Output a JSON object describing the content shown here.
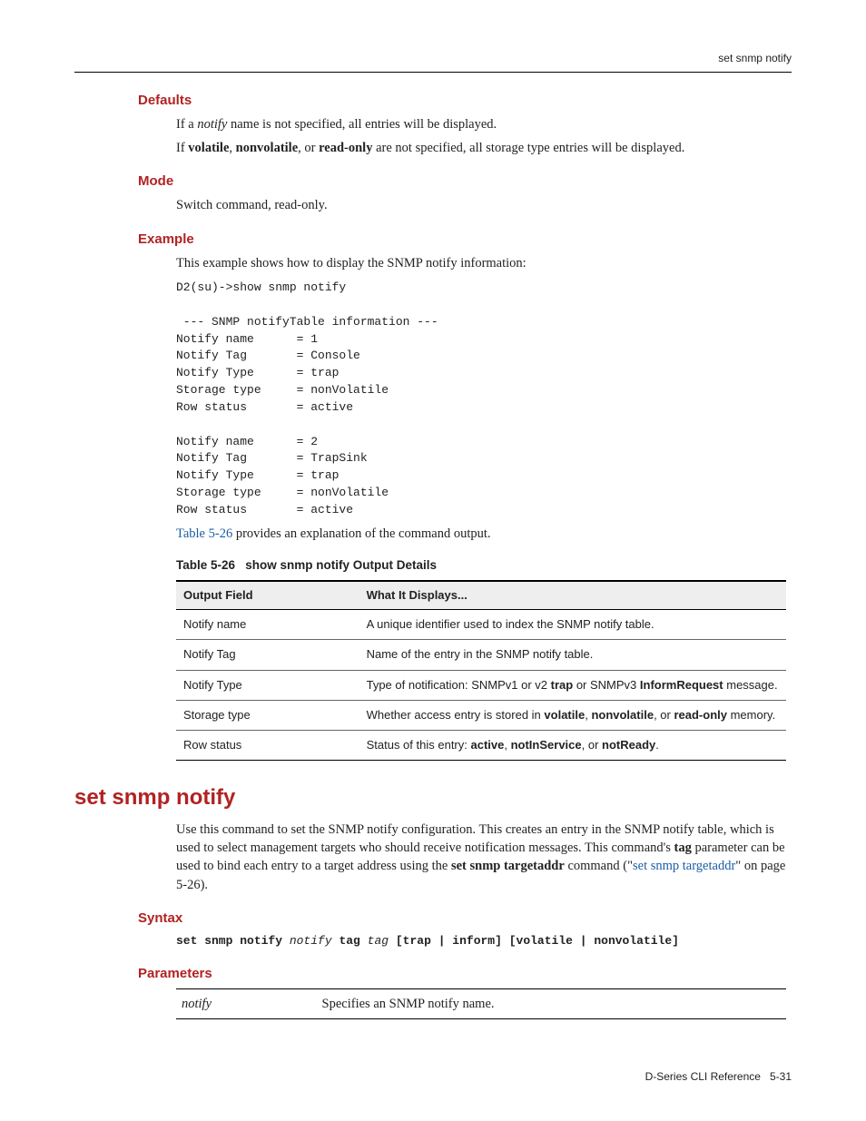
{
  "header": {
    "running": "set snmp notify"
  },
  "defaults": {
    "heading": "Defaults",
    "p1_pre": "If a ",
    "p1_it": "notify",
    "p1_post": " name is not specified, all entries will be displayed.",
    "p2_pre": "If ",
    "p2_b1": "volatile",
    "p2_sep1": ", ",
    "p2_b2": "nonvolatile",
    "p2_sep2": ", or ",
    "p2_b3": "read-only",
    "p2_post": " are not specified, all storage type entries will be displayed."
  },
  "mode": {
    "heading": "Mode",
    "p": "Switch command, read-only."
  },
  "example": {
    "heading": "Example",
    "p": "This example shows how to display the SNMP notify information:",
    "code": "D2(su)->show snmp notify\n\n --- SNMP notifyTable information ---\nNotify name      = 1\nNotify Tag       = Console\nNotify Type      = trap\nStorage type     = nonVolatile\nRow status       = active\n\nNotify name      = 2\nNotify Tag       = TrapSink\nNotify Type      = trap\nStorage type     = nonVolatile\nRow status       = active",
    "post_link": "Table 5‑26",
    "post_rest": " provides an explanation of the command output."
  },
  "table": {
    "caption_num": "Table 5-26",
    "caption_title": "show snmp notify Output Details",
    "headers": {
      "c1": "Output Field",
      "c2": "What It Displays..."
    },
    "rows": [
      {
        "field": "Notify name",
        "desc_pre": "A unique identifier used to index the SNMP notify table.",
        "b1": "",
        "mid1": "",
        "b2": "",
        "mid2": "",
        "b3": "",
        "tail": ""
      },
      {
        "field": "Notify Tag",
        "desc_pre": "Name of the entry in the SNMP notify table.",
        "b1": "",
        "mid1": "",
        "b2": "",
        "mid2": "",
        "b3": "",
        "tail": ""
      },
      {
        "field": "Notify Type",
        "desc_pre": "Type of notification: SNMPv1 or v2 ",
        "b1": "trap",
        "mid1": " or SNMPv3 ",
        "b2": "InformRequest",
        "mid2": "",
        "b3": "",
        "tail": " message."
      },
      {
        "field": "Storage type",
        "desc_pre": "Whether access entry is stored in ",
        "b1": "volatile",
        "mid1": ", ",
        "b2": "nonvolatile",
        "mid2": ", or ",
        "b3": "read-only",
        "tail": " memory."
      },
      {
        "field": "Row status",
        "desc_pre": "Status of this entry: ",
        "b1": "active",
        "mid1": ", ",
        "b2": "notInService",
        "mid2": ", or ",
        "b3": "notReady",
        "tail": "."
      }
    ]
  },
  "set": {
    "heading": "set snmp notify",
    "p1_a": "Use this command to set the SNMP notify configuration. This creates an entry in the SNMP notify table, which is used to select management targets who should receive notification messages. This command's ",
    "p1_b": "tag",
    "p1_c": " parameter can be used to bind each entry to a target address using the ",
    "p1_d": "set snmp targetaddr",
    "p1_e": " command (\"",
    "p1_link": "set snmp targetaddr",
    "p1_f": "\" on page 5‑26)."
  },
  "syntax": {
    "heading": "Syntax",
    "s1": "set snmp notify ",
    "a1": "notify",
    "s2": " tag ",
    "a2": "tag",
    "s3": " [",
    "s4": "trap",
    "s5": " | ",
    "s6": "inform",
    "s7": "] [",
    "s8": "volatile",
    "s9": " | ",
    "s10": "nonvolatile",
    "s11": "]"
  },
  "params": {
    "heading": "Parameters",
    "rows": [
      {
        "name": "notify",
        "desc": "Specifies an SNMP notify name."
      }
    ]
  },
  "footer": {
    "left": "D-Series CLI Reference",
    "right": "5-31"
  }
}
